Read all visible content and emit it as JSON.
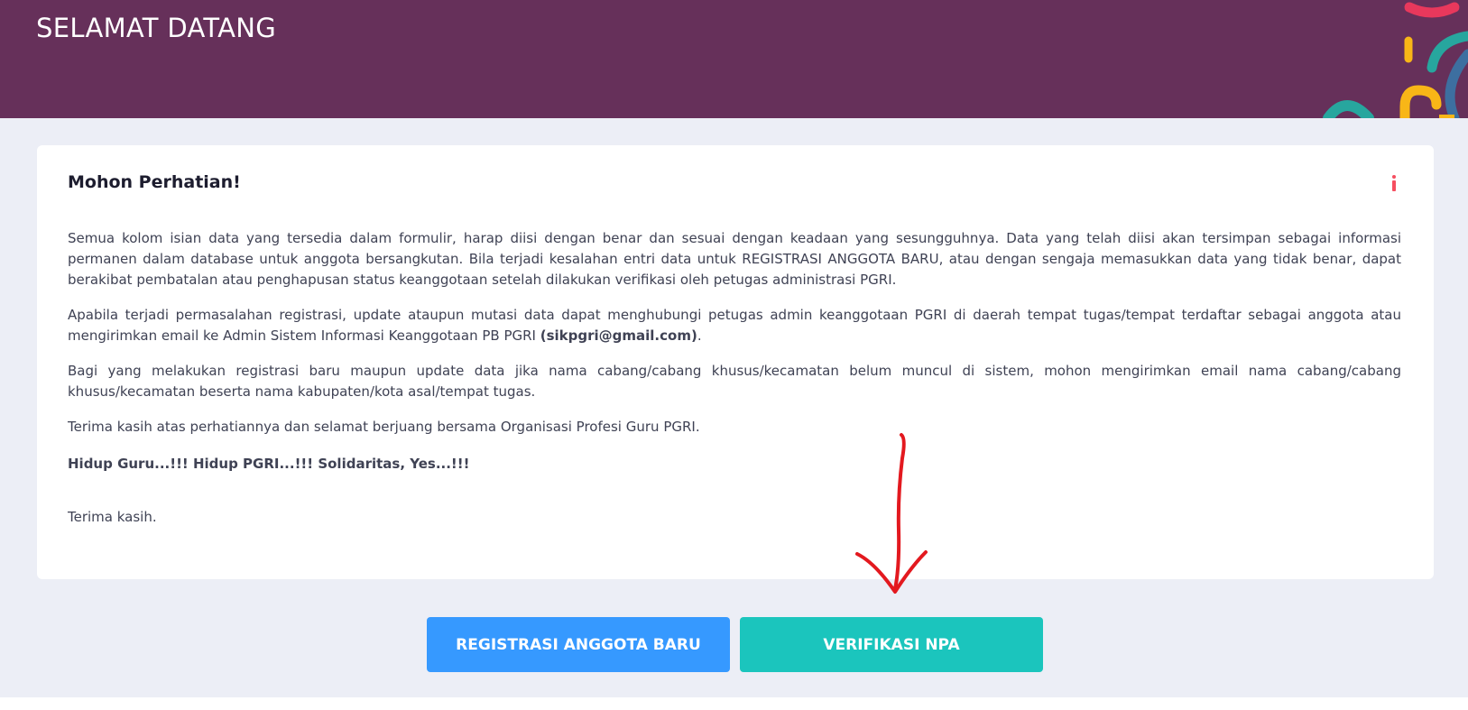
{
  "header": {
    "title": "SELAMAT DATANG"
  },
  "notice": {
    "title": "Mohon Perhatian!",
    "icon": "info-icon",
    "paragraph1": "Semua kolom isian data yang tersedia dalam formulir, harap diisi dengan benar dan sesuai dengan keadaan yang sesungguhnya. Data yang telah diisi akan tersimpan sebagai informasi permanen dalam database untuk anggota bersangkutan. Bila terjadi kesalahan entri data untuk REGISTRASI ANGGOTA BARU, atau dengan sengaja memasukkan data yang tidak benar, dapat berakibat pembatalan atau penghapusan status keanggotaan setelah dilakukan verifikasi oleh petugas administrasi PGRI.",
    "paragraph2_pre": "Apabila terjadi permasalahan registrasi, update ataupun mutasi data dapat menghubungi petugas admin keanggotaan PGRI di daerah tempat tugas/tempat terdaftar sebagai anggota atau mengirimkan email ke Admin Sistem Informasi Keanggotaan PB PGRI ",
    "paragraph2_email": "(sikpgri@gmail.com)",
    "paragraph2_post": ".",
    "paragraph3": "Bagi yang melakukan registrasi baru maupun update data jika nama cabang/cabang khusus/kecamatan belum muncul di sistem, mohon mengirimkan email nama cabang/cabang khusus/kecamatan beserta nama kabupaten/kota asal/tempat tugas.",
    "paragraph4": "Terima kasih atas perhatiannya dan selamat berjuang bersama Organisasi Profesi Guru PGRI.",
    "slogan": "Hidup Guru...!!! Hidup PGRI...!!! Solidaritas, Yes...!!!",
    "closing": "Terima kasih."
  },
  "actions": {
    "register_label": "REGISTRASI ANGGOTA BARU",
    "verify_label": "VERIFIKASI NPA"
  },
  "colors": {
    "header_bg": "#66305a",
    "page_bg": "#eceef6",
    "register_button": "#3699ff",
    "verify_button": "#1bc5bd",
    "info_icon": "#f64e60",
    "annotation_arrow": "#e3191f"
  }
}
